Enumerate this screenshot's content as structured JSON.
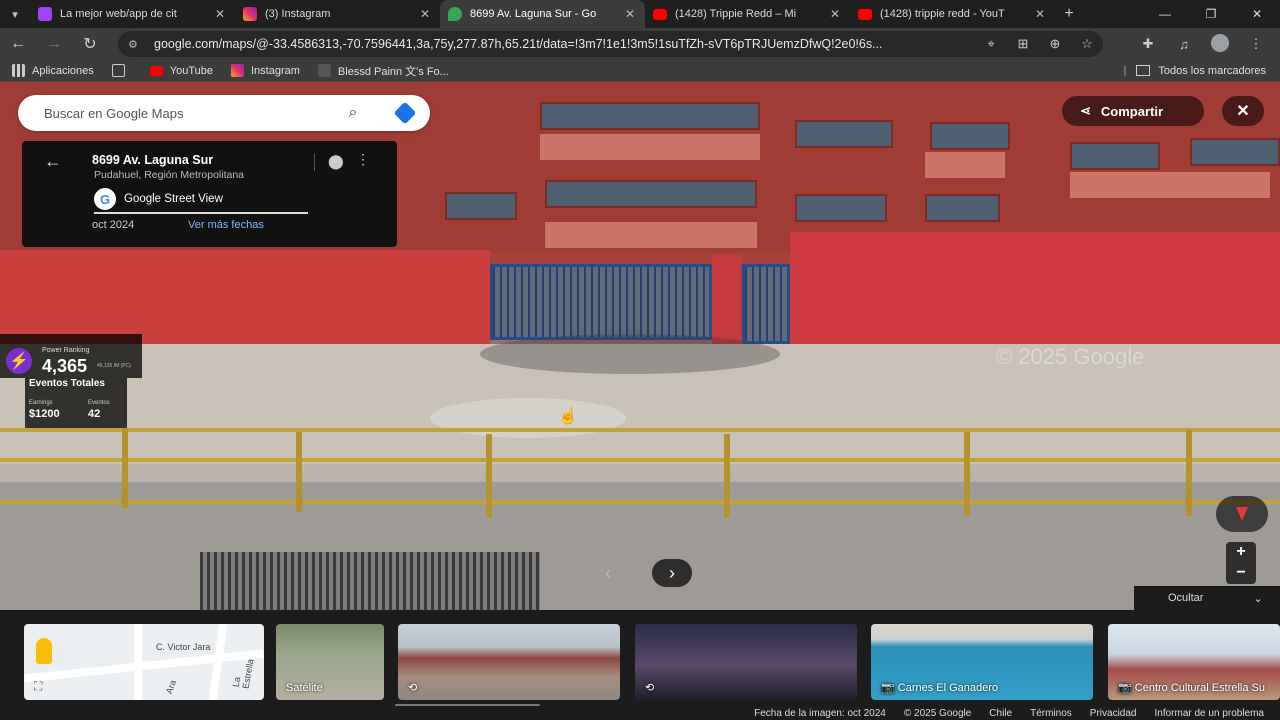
{
  "tabs": [
    {
      "title": "La mejor web/app de cit",
      "icon": "messenger-icon",
      "color": "#a142f4"
    },
    {
      "title": "(3) Instagram",
      "icon": "instagram-icon",
      "color": "#e1306c"
    },
    {
      "title": "8699 Av. Laguna Sur - Go",
      "icon": "google-maps-icon",
      "color": "#34a853",
      "active": true
    },
    {
      "title": "(1428) Trippie Redd – Mi",
      "icon": "youtube-icon",
      "color": "#ff0000"
    },
    {
      "title": "(1428) trippie redd - YouT",
      "icon": "youtube-icon",
      "color": "#ff0000"
    }
  ],
  "toolbar": {
    "url": "google.com/maps/@-33.4586313,-70.7596441,3a,75y,277.87h,65.21t/data=!3m7!1e1!3m5!1suTfZh-sVT6pTRJUemzDfwQ!2e0!6s..."
  },
  "bookmarks": {
    "apps": "Aplicaciones",
    "items": [
      {
        "label": "YouTube",
        "color": "#ff0000"
      },
      {
        "label": "Instagram",
        "color": "#e1306c"
      },
      {
        "label": "Blessd Painn 文's Fo...",
        "color": "#555555"
      }
    ],
    "all": "Todos los marcadores"
  },
  "maps": {
    "search_placeholder": "Buscar en Google Maps",
    "place": {
      "address": "8699 Av. Laguna Sur",
      "region": "Pudahuel, Región Metropolitana",
      "source": "Google Street View",
      "date": "oct 2024",
      "more_dates": "Ver más fechas"
    },
    "share_label": "Compartir",
    "watermark": "© 2025 Google",
    "hide_label": "Ocultar"
  },
  "overlay": {
    "power_ranking_label": "Power Ranking",
    "power_ranking_value": "4,365",
    "power_ranking_sub": "45,126 IM (PC)",
    "events_title": "Eventos Totales",
    "earnings_label": "Earnings",
    "earnings_value": "$1200",
    "events_label": "Eventos",
    "events_value": "42"
  },
  "filmstrip": {
    "map_streets": [
      "C. Victor Jara",
      "La Estrella",
      "Ara"
    ],
    "thumbs": [
      {
        "label": "Satélite"
      },
      {
        "label": ""
      },
      {
        "label": ""
      },
      {
        "label": "Carnes El Ganadero"
      },
      {
        "label": "Centro Cultural Estrella Su"
      }
    ]
  },
  "footer": {
    "image_date": "Fecha de la imagen: oct 2024",
    "copyright": "© 2025 Google",
    "country": "Chile",
    "terms": "Términos",
    "privacy": "Privacidad",
    "report": "Informar de un problema"
  }
}
